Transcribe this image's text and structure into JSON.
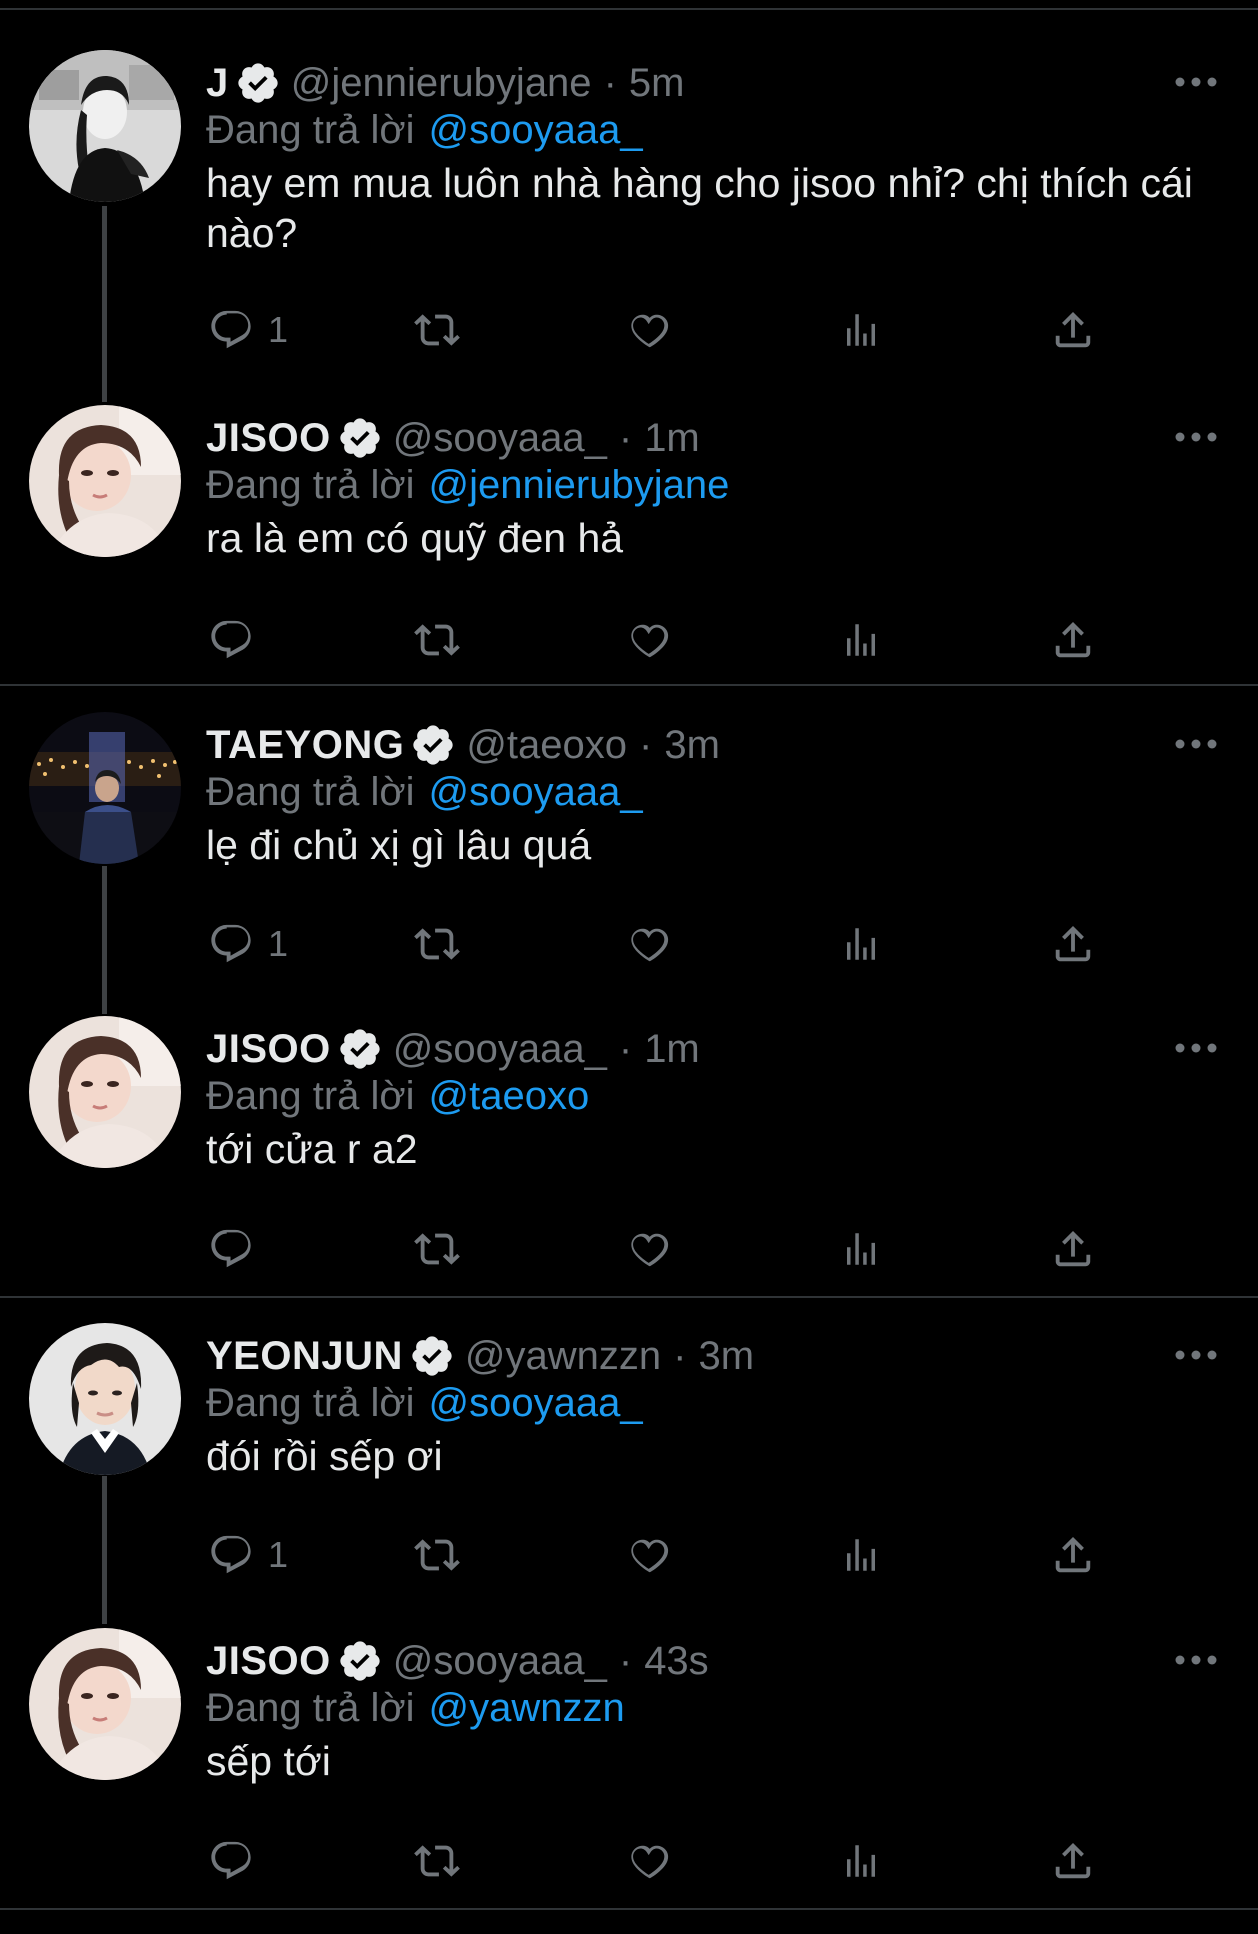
{
  "ui": {
    "replying_label": "Đang trả lời"
  },
  "colors": {
    "background": "#000000",
    "text": "#e7e9ea",
    "muted": "#71767b",
    "link": "#1d9bf0",
    "separator": "#2f3336"
  },
  "tweets": [
    {
      "name": "J",
      "handle": "@jennierubyjane",
      "dot": "·",
      "time": "5m",
      "verified": true,
      "replying_to": "@sooyaaa_",
      "text": "hay em mua luôn nhà hàng cho jisoo nhỉ? chị thích cái nào?",
      "reply_count": "1",
      "more_icon": "more-horizontal-icon"
    },
    {
      "name": "JISOO",
      "handle": "@sooyaaa_",
      "dot": "·",
      "time": "1m",
      "verified": true,
      "replying_to": "@jennierubyjane",
      "text": "ra là em có quỹ đen hả",
      "reply_count": "",
      "more_icon": "more-horizontal-icon"
    },
    {
      "name": "TAEYONG",
      "handle": "@taeoxo",
      "dot": "·",
      "time": "3m",
      "verified": true,
      "replying_to": "@sooyaaa_",
      "text": "lẹ đi chủ xị gì lâu quá",
      "reply_count": "1",
      "more_icon": "more-horizontal-icon"
    },
    {
      "name": "JISOO",
      "handle": "@sooyaaa_",
      "dot": "·",
      "time": "1m",
      "verified": true,
      "replying_to": "@taeoxo",
      "text": "tới cửa r a2",
      "reply_count": "",
      "more_icon": "more-horizontal-icon"
    },
    {
      "name": "YEONJUN",
      "handle": "@yawnzzn",
      "dot": "·",
      "time": "3m",
      "verified": true,
      "replying_to": "@sooyaaa_",
      "text": "đói rồi sếp ơi",
      "reply_count": "1",
      "more_icon": "more-horizontal-icon"
    },
    {
      "name": "JISOO",
      "handle": "@sooyaaa_",
      "dot": "·",
      "time": "43s",
      "verified": true,
      "replying_to": "@yawnzzn",
      "text": "sếp tới",
      "reply_count": "",
      "more_icon": "more-horizontal-icon"
    }
  ],
  "action_icons": [
    "reply-icon",
    "retweet-icon",
    "like-icon",
    "views-icon",
    "share-icon"
  ]
}
